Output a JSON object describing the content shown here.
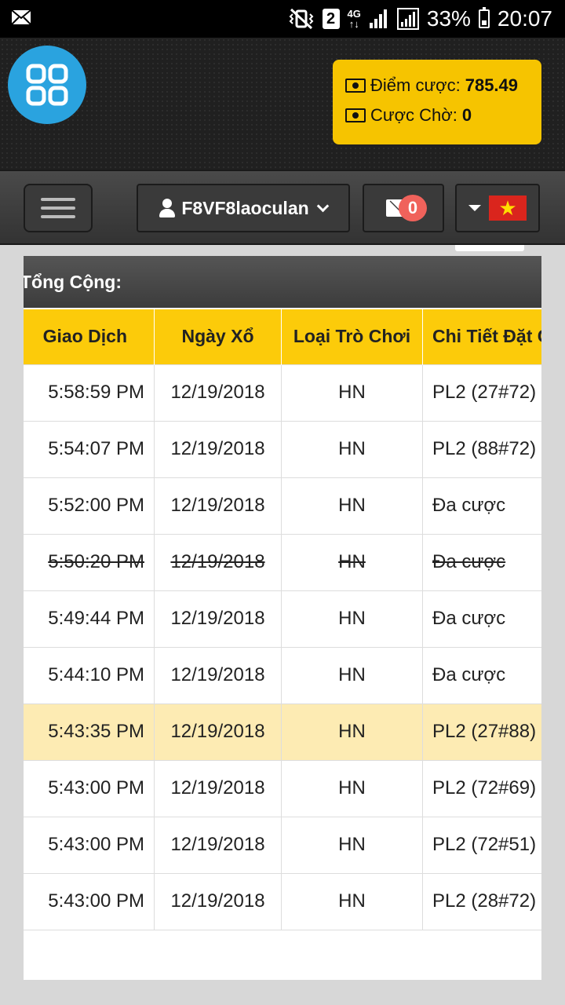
{
  "status_bar": {
    "signal_label": "4G",
    "sim_slot": "2",
    "battery": "33%",
    "time": "20:07"
  },
  "header": {
    "balance_label": "Điểm cược:",
    "balance_value": "785.49",
    "pending_label": "Cược Chờ:",
    "pending_value": "0"
  },
  "navbar": {
    "username": "F8VF8laoculan",
    "mail_count": "0"
  },
  "summary": {
    "total_label": "Tổng Cộng:"
  },
  "table": {
    "headers": [
      "Giao Dịch",
      "Ngày Xổ",
      "Loại Trò Chơi",
      "Chi Tiết Đặt Cược"
    ],
    "rows": [
      {
        "time": "5:58:59 PM",
        "date": "12/19/2018",
        "game": "HN",
        "detail": "PL2 (27#72)"
      },
      {
        "time": "5:54:07 PM",
        "date": "12/19/2018",
        "game": "HN",
        "detail": "PL2 (88#72)"
      },
      {
        "time": "5:52:00 PM",
        "date": "12/19/2018",
        "game": "HN",
        "detail": "Đa cược"
      },
      {
        "time": "5:50:20 PM",
        "date": "12/19/2018",
        "game": "HN",
        "detail": "Đa cược"
      },
      {
        "time": "5:49:44 PM",
        "date": "12/19/2018",
        "game": "HN",
        "detail": "Đa cược"
      },
      {
        "time": "5:44:10 PM",
        "date": "12/19/2018",
        "game": "HN",
        "detail": "Đa cược"
      },
      {
        "time": "5:43:35 PM",
        "date": "12/19/2018",
        "game": "HN",
        "detail": "PL2 (27#88)"
      },
      {
        "time": "5:43:00 PM",
        "date": "12/19/2018",
        "game": "HN",
        "detail": "PL2 (72#69)"
      },
      {
        "time": "5:43:00 PM",
        "date": "12/19/2018",
        "game": "HN",
        "detail": "PL2 (72#51)"
      },
      {
        "time": "5:43:00 PM",
        "date": "12/19/2018",
        "game": "HN",
        "detail": "PL2 (28#72)"
      }
    ]
  },
  "colors": {
    "accent_yellow": "#fccb0a",
    "logo_blue": "#2aa3df",
    "badge_red": "#f0625b",
    "highlight_row": "#fdebb3"
  }
}
